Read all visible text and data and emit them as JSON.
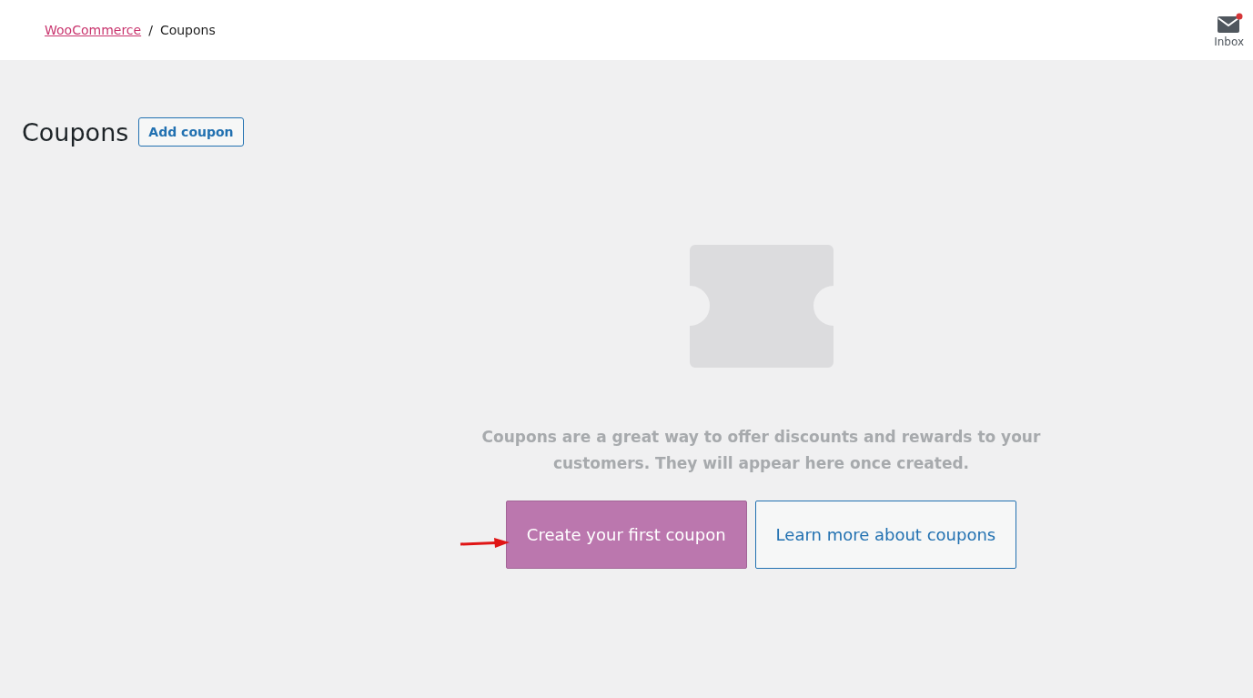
{
  "breadcrumb": [
    {
      "label": "WooCommerce",
      "link": true
    },
    {
      "label": "Coupons",
      "link": false
    }
  ],
  "separator": "/",
  "inbox": {
    "label": "Inbox",
    "unread": true
  },
  "page_title": "Coupons",
  "add_button": "Add coupon",
  "empty_state": {
    "message": "Coupons are a great way to offer discounts and rewards to your customers. They will appear here once created.",
    "buttons": [
      {
        "label": "Create your first coupon",
        "kind": "primary"
      },
      {
        "label": "Learn more about coupons",
        "kind": "secondary"
      }
    ]
  }
}
